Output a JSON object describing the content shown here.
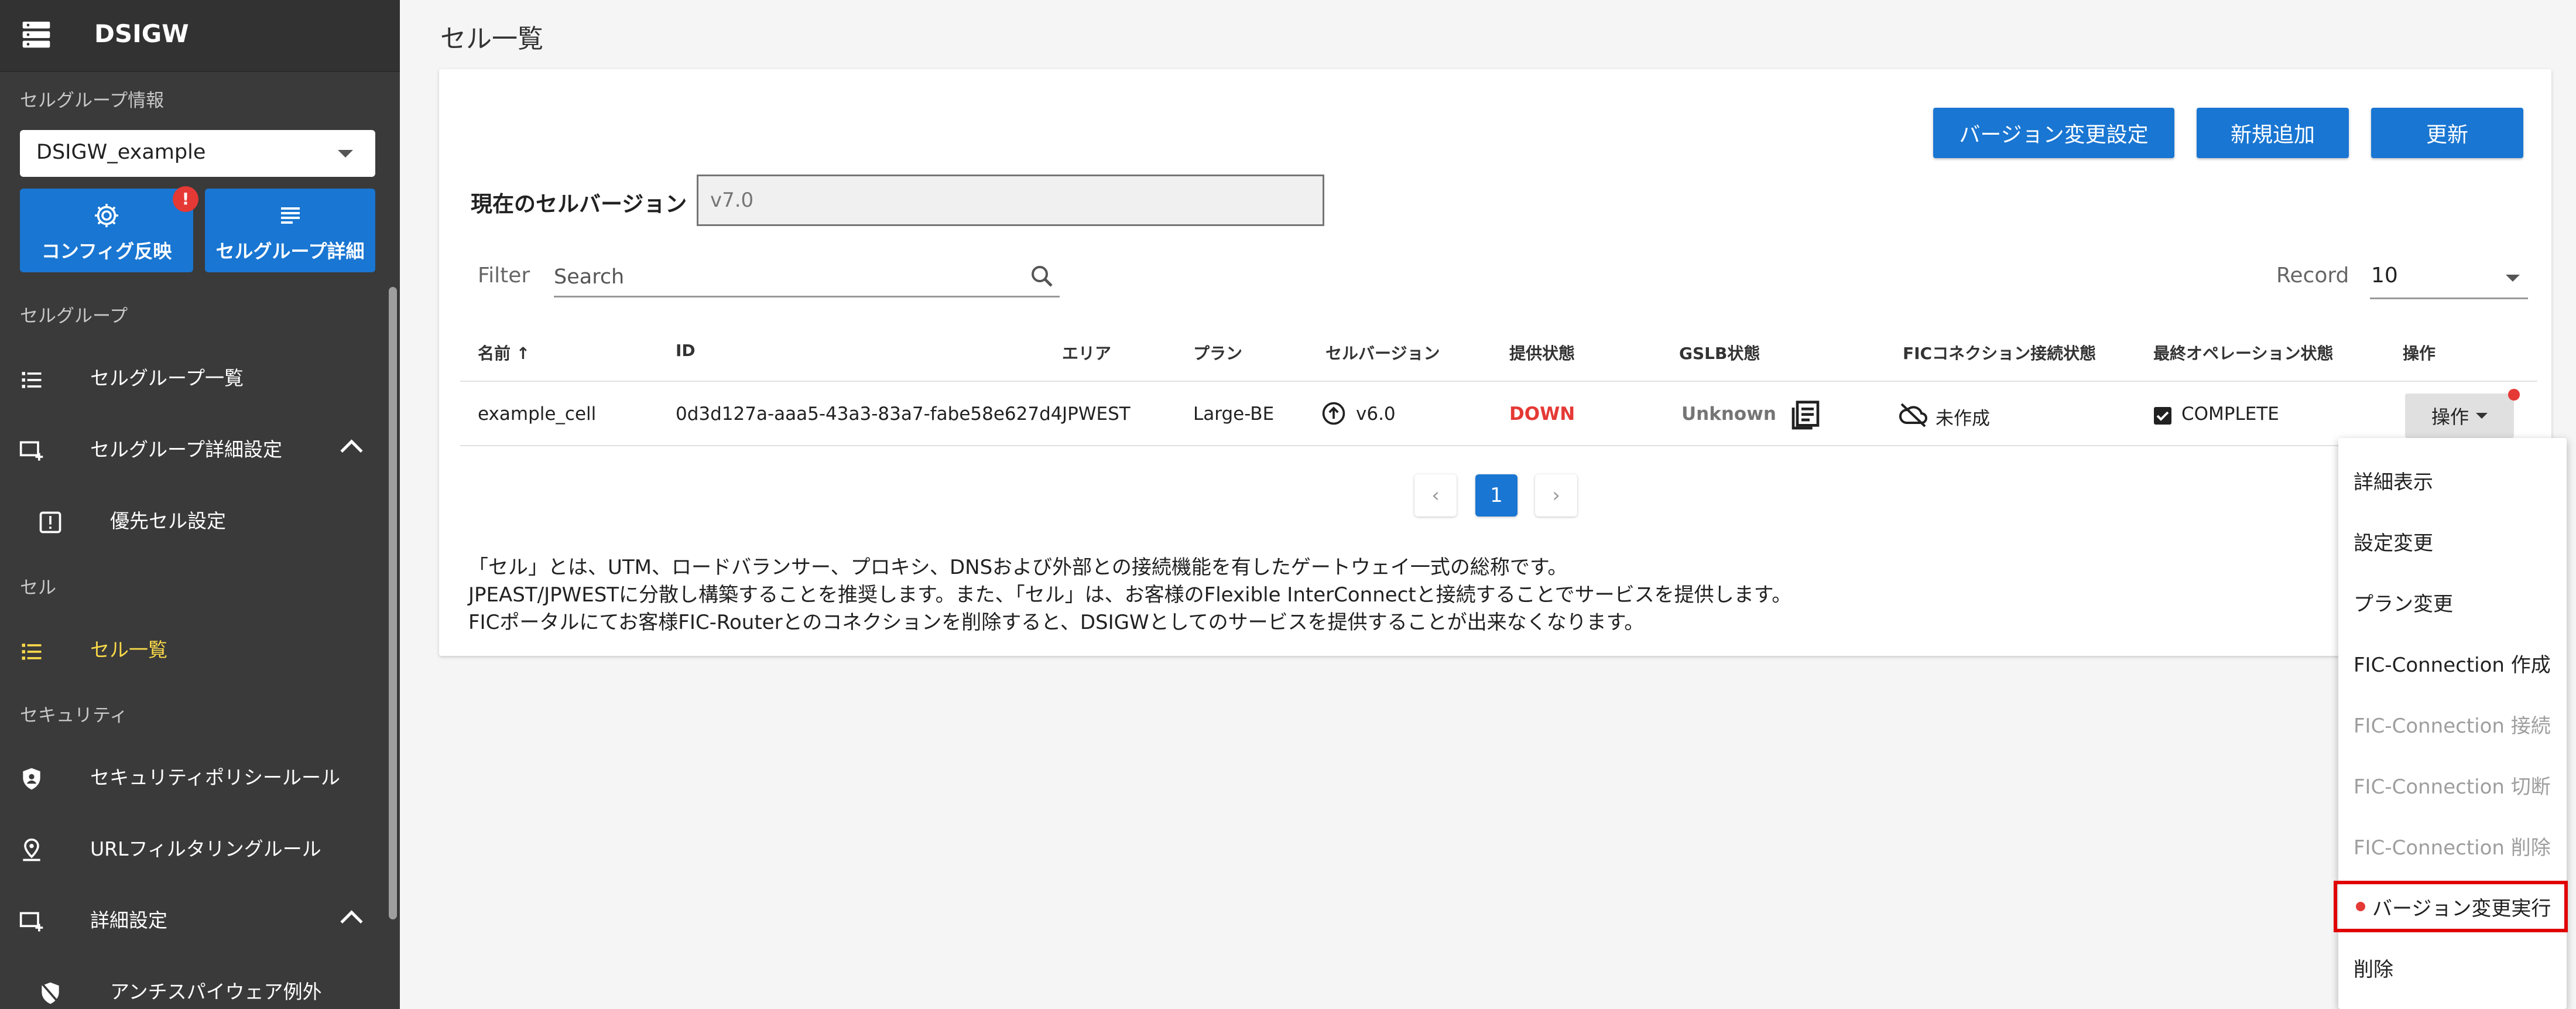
{
  "app": {
    "title": "DSIGW"
  },
  "sidebar": {
    "group_info_label": "セルグループ情報",
    "group_select_value": "DSIGW_example",
    "config_button_label": "コンフィグ反映",
    "config_badge": "!",
    "group_detail_button_label": "セルグループ詳細",
    "section_cell_group": "セルグループ",
    "items_cell_group": [
      {
        "label": "セルグループ一覧",
        "icon": "list-icon"
      },
      {
        "label": "セルグループ詳細設定",
        "icon": "add-to-queue-icon"
      },
      {
        "label": "優先セル設定",
        "icon": "priority-icon"
      }
    ],
    "section_cell": "セル",
    "item_cell_list": "セル一覧",
    "section_security": "セキュリティ",
    "items_security": [
      {
        "label": "セキュリティポリシールール",
        "icon": "shield-person-icon"
      },
      {
        "label": "URLフィルタリングルール",
        "icon": "location-icon"
      },
      {
        "label": "詳細設定",
        "icon": "add-to-queue-icon"
      },
      {
        "label": "アンチスパイウェア例外",
        "icon": "shield-slash-icon"
      }
    ]
  },
  "main": {
    "page_title": "セル一覧",
    "buttons": {
      "version_setting": "バージョン変更設定",
      "add_new": "新規追加",
      "refresh": "更新"
    },
    "current_version_label": "現在のセルバージョン",
    "current_version_value": "v7.0",
    "filter_label": "Filter",
    "search_placeholder": "Search",
    "record_label": "Record",
    "record_value": "10",
    "table": {
      "headers": [
        "名前 ↑",
        "ID",
        "エリア",
        "プラン",
        "セルバージョン",
        "提供状態",
        "GSLB状態",
        "FICコネクション接続状態",
        "最終オペレーション状態",
        "操作"
      ],
      "row": {
        "name": "example_cell",
        "id": "0d3d127a-aaa5-43a3-83a7-fabe58e627d4",
        "area": "JPWEST",
        "plan": "Large-BE",
        "cell_version": "v6.0",
        "status": "DOWN",
        "gslb": "Unknown",
        "fic": "未作成",
        "last_op": "COMPLETE",
        "op_button": "操作"
      }
    },
    "pagination": {
      "prev": "‹",
      "current": "1",
      "next": "›"
    },
    "notes": [
      "「セル」とは、UTM、ロードバランサー、プロキシ、DNSおよび外部との接続機能を有したゲートウェイ一式の総称です。",
      "JPEAST/JPWESTに分散し構築することを推奨します。また、「セル」は、お客様のFlexible InterConnectと接続することでサービスを提供します。",
      "FICポータルにてお客様FIC-Routerとのコネクションを削除すると、DSIGWとしてのサービスを提供することが出来なくなります。"
    ]
  },
  "menu": {
    "items": [
      {
        "label": "詳細表示",
        "enabled": true
      },
      {
        "label": "設定変更",
        "enabled": true
      },
      {
        "label": "プラン変更",
        "enabled": true
      },
      {
        "label": "FIC-Connection 作成",
        "enabled": true
      },
      {
        "label": "FIC-Connection 接続",
        "enabled": false
      },
      {
        "label": "FIC-Connection 切断",
        "enabled": false
      },
      {
        "label": "FIC-Connection 削除",
        "enabled": false
      },
      {
        "label": "バージョン変更実行",
        "enabled": true
      },
      {
        "label": "削除",
        "enabled": true
      }
    ]
  },
  "colors": {
    "primary": "#1976d2",
    "sidebar_bg": "#3a3a3a",
    "active": "#f9d949",
    "error": "#e53935",
    "highlight": "#e00000"
  }
}
